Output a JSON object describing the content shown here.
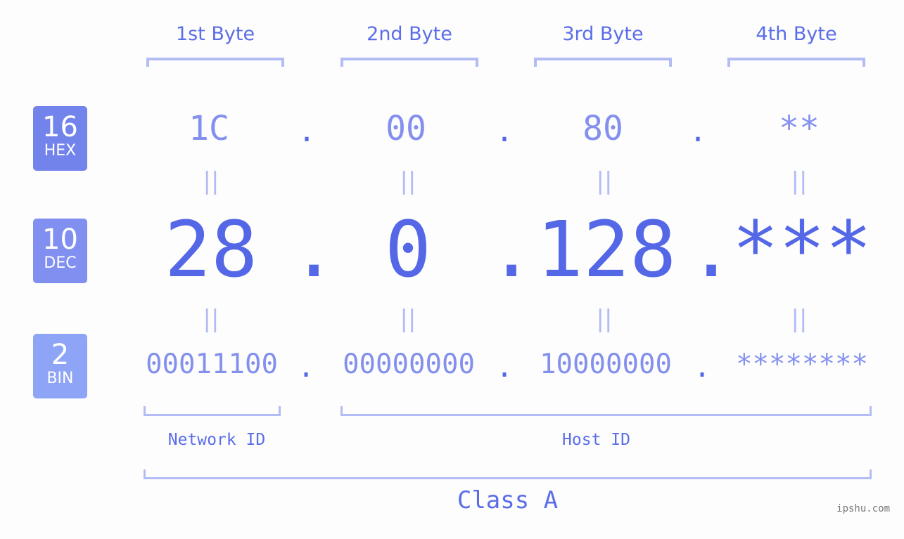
{
  "bytes": [
    {
      "header": "1st Byte",
      "hex": "1C",
      "dec": "28",
      "bin": "00011100"
    },
    {
      "header": "2nd Byte",
      "hex": "00",
      "dec": "0",
      "bin": "00000000"
    },
    {
      "header": "3rd Byte",
      "hex": "80",
      "dec": "128",
      "bin": "10000000"
    },
    {
      "header": "4th Byte",
      "hex": "**",
      "dec": "***",
      "bin": "********"
    }
  ],
  "separator": ".",
  "equals": "||",
  "bases": [
    {
      "number": "16",
      "label": "HEX",
      "color": "#7383ec"
    },
    {
      "number": "10",
      "label": "DEC",
      "color": "#8190f0"
    },
    {
      "number": "2",
      "label": "BIN",
      "color": "#8ea4f6"
    }
  ],
  "segments": {
    "network": "Network ID",
    "host": "Host ID",
    "class": "Class A"
  },
  "watermark": "ipshu.com",
  "colors": {
    "accent": "#5467e6",
    "light": "#8490ee",
    "bracket": "#b3bcf5"
  }
}
